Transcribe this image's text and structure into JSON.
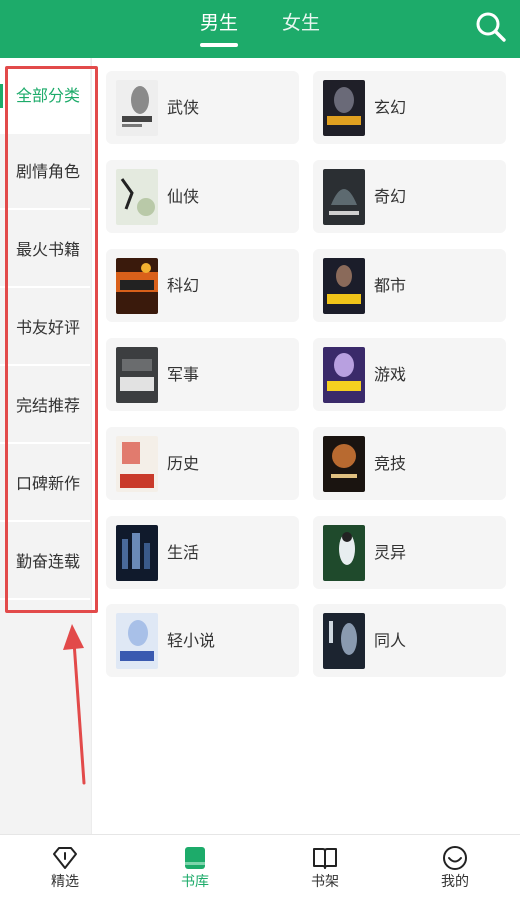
{
  "header": {
    "tabs": [
      {
        "label": "男生",
        "active": true
      },
      {
        "label": "女生",
        "active": false
      }
    ],
    "search_icon": "search-icon",
    "brand_color": "#1dab6a"
  },
  "sidebar": {
    "items": [
      {
        "label": "全部分类",
        "active": true
      },
      {
        "label": "剧情角色",
        "active": false
      },
      {
        "label": "最火书籍",
        "active": false
      },
      {
        "label": "书友好评",
        "active": false
      },
      {
        "label": "完结推荐",
        "active": false
      },
      {
        "label": "口碑新作",
        "active": false
      },
      {
        "label": "勤奋连载",
        "active": false
      }
    ]
  },
  "categories": [
    {
      "label": "武侠"
    },
    {
      "label": "玄幻"
    },
    {
      "label": "仙侠"
    },
    {
      "label": "奇幻"
    },
    {
      "label": "科幻"
    },
    {
      "label": "都市"
    },
    {
      "label": "军事"
    },
    {
      "label": "游戏"
    },
    {
      "label": "历史"
    },
    {
      "label": "竞技"
    },
    {
      "label": "生活"
    },
    {
      "label": "灵异"
    },
    {
      "label": "轻小说"
    },
    {
      "label": "同人"
    }
  ],
  "annotation": {
    "highlight_color": "#e24a4a"
  },
  "bottom_nav": {
    "items": [
      {
        "label": "精选",
        "icon": "diamond-icon",
        "active": false
      },
      {
        "label": "书库",
        "icon": "book-icon",
        "active": true
      },
      {
        "label": "书架",
        "icon": "open-book-icon",
        "active": false
      },
      {
        "label": "我的",
        "icon": "smile-icon",
        "active": false
      }
    ]
  }
}
